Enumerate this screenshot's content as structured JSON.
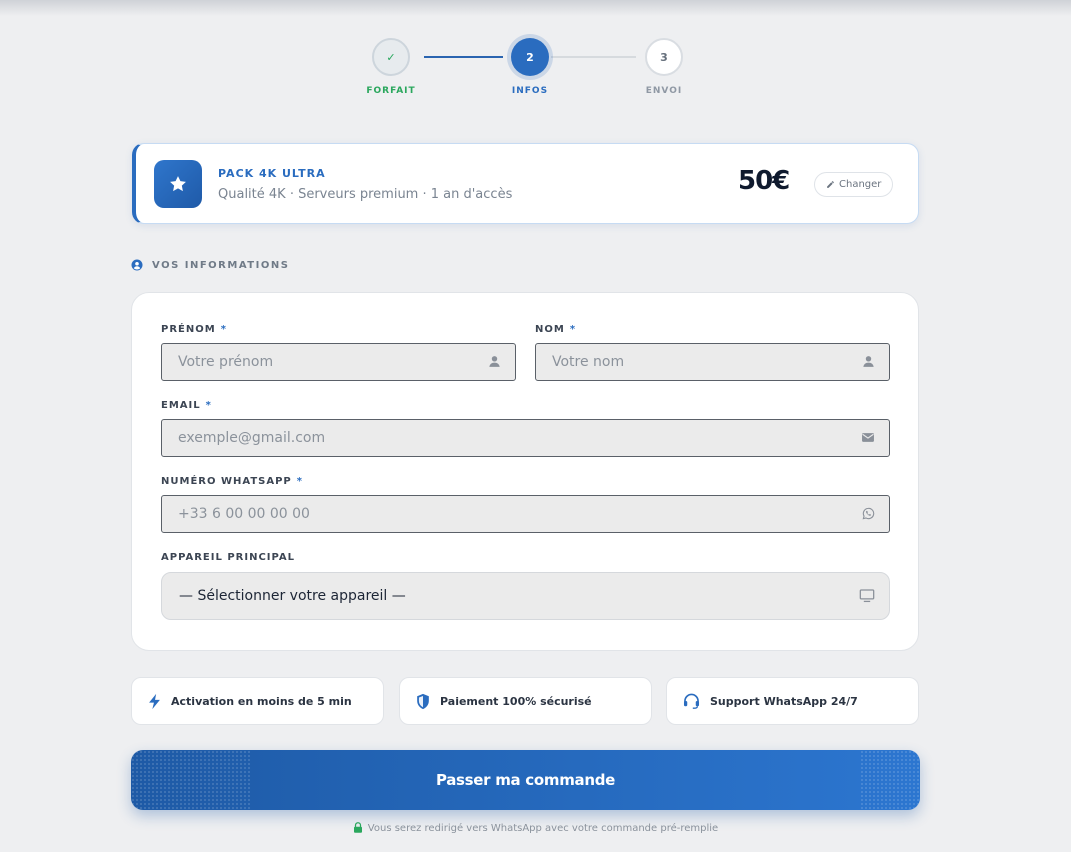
{
  "stepper": {
    "steps": [
      {
        "number": "✓",
        "label": "FORFAIT",
        "state": "done"
      },
      {
        "number": "2",
        "label": "INFOS",
        "state": "active"
      },
      {
        "number": "3",
        "label": "ENVOI",
        "state": "pending"
      }
    ]
  },
  "pack": {
    "icon": "star-icon",
    "title": "PACK 4K ULTRA",
    "subtitle": "Qualité 4K · Serveurs premium · 1 an d'accès",
    "price": "50€",
    "change_label": "Changer"
  },
  "section": {
    "title": "VOS INFORMATIONS",
    "icon": "user-circle-icon"
  },
  "form": {
    "prenom": {
      "label": "PRÉNOM",
      "required": "*",
      "placeholder": "Votre prénom",
      "icon": "user-icon"
    },
    "nom": {
      "label": "NOM",
      "required": "*",
      "placeholder": "Votre nom",
      "icon": "user-icon"
    },
    "email": {
      "label": "EMAIL",
      "required": "*",
      "placeholder": "exemple@gmail.com",
      "icon": "envelope-icon"
    },
    "whatsapp": {
      "label": "NUMÉRO WHATSAPP",
      "required": "*",
      "placeholder": "+33 6 00 00 00 00",
      "icon": "whatsapp-icon"
    },
    "device": {
      "label": "APPAREIL PRINCIPAL",
      "selected": "— Sélectionner votre appareil —",
      "icon": "monitor-icon"
    }
  },
  "features": [
    {
      "icon": "bolt-icon",
      "label": "Activation en moins de 5 min"
    },
    {
      "icon": "shield-icon",
      "label": "Paiement 100% sécurisé"
    },
    {
      "icon": "headset-icon",
      "label": "Support WhatsApp 24/7"
    }
  ],
  "cta": {
    "label": "Passer ma commande"
  },
  "footer": {
    "note": "Vous serez redirigé vers WhatsApp avec votre commande pré-remplie",
    "icon": "lock-icon"
  },
  "colors": {
    "accent": "#2a6cbf",
    "success": "#2aa75d",
    "background": "#eeeff1"
  }
}
